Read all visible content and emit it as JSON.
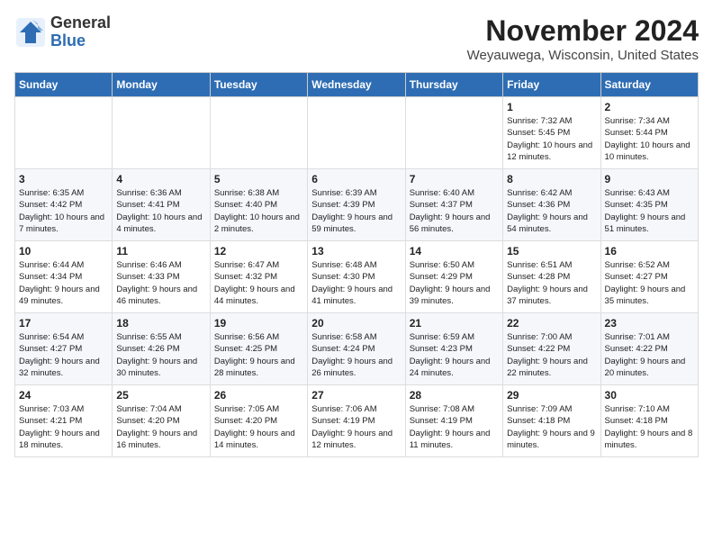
{
  "header": {
    "logo_general": "General",
    "logo_blue": "Blue",
    "month_title": "November 2024",
    "location": "Weyauwega, Wisconsin, United States"
  },
  "weekdays": [
    "Sunday",
    "Monday",
    "Tuesday",
    "Wednesday",
    "Thursday",
    "Friday",
    "Saturday"
  ],
  "weeks": [
    [
      {
        "day": "",
        "info": ""
      },
      {
        "day": "",
        "info": ""
      },
      {
        "day": "",
        "info": ""
      },
      {
        "day": "",
        "info": ""
      },
      {
        "day": "",
        "info": ""
      },
      {
        "day": "1",
        "info": "Sunrise: 7:32 AM\nSunset: 5:45 PM\nDaylight: 10 hours and 12 minutes."
      },
      {
        "day": "2",
        "info": "Sunrise: 7:34 AM\nSunset: 5:44 PM\nDaylight: 10 hours and 10 minutes."
      }
    ],
    [
      {
        "day": "3",
        "info": "Sunrise: 6:35 AM\nSunset: 4:42 PM\nDaylight: 10 hours and 7 minutes."
      },
      {
        "day": "4",
        "info": "Sunrise: 6:36 AM\nSunset: 4:41 PM\nDaylight: 10 hours and 4 minutes."
      },
      {
        "day": "5",
        "info": "Sunrise: 6:38 AM\nSunset: 4:40 PM\nDaylight: 10 hours and 2 minutes."
      },
      {
        "day": "6",
        "info": "Sunrise: 6:39 AM\nSunset: 4:39 PM\nDaylight: 9 hours and 59 minutes."
      },
      {
        "day": "7",
        "info": "Sunrise: 6:40 AM\nSunset: 4:37 PM\nDaylight: 9 hours and 56 minutes."
      },
      {
        "day": "8",
        "info": "Sunrise: 6:42 AM\nSunset: 4:36 PM\nDaylight: 9 hours and 54 minutes."
      },
      {
        "day": "9",
        "info": "Sunrise: 6:43 AM\nSunset: 4:35 PM\nDaylight: 9 hours and 51 minutes."
      }
    ],
    [
      {
        "day": "10",
        "info": "Sunrise: 6:44 AM\nSunset: 4:34 PM\nDaylight: 9 hours and 49 minutes."
      },
      {
        "day": "11",
        "info": "Sunrise: 6:46 AM\nSunset: 4:33 PM\nDaylight: 9 hours and 46 minutes."
      },
      {
        "day": "12",
        "info": "Sunrise: 6:47 AM\nSunset: 4:32 PM\nDaylight: 9 hours and 44 minutes."
      },
      {
        "day": "13",
        "info": "Sunrise: 6:48 AM\nSunset: 4:30 PM\nDaylight: 9 hours and 41 minutes."
      },
      {
        "day": "14",
        "info": "Sunrise: 6:50 AM\nSunset: 4:29 PM\nDaylight: 9 hours and 39 minutes."
      },
      {
        "day": "15",
        "info": "Sunrise: 6:51 AM\nSunset: 4:28 PM\nDaylight: 9 hours and 37 minutes."
      },
      {
        "day": "16",
        "info": "Sunrise: 6:52 AM\nSunset: 4:27 PM\nDaylight: 9 hours and 35 minutes."
      }
    ],
    [
      {
        "day": "17",
        "info": "Sunrise: 6:54 AM\nSunset: 4:27 PM\nDaylight: 9 hours and 32 minutes."
      },
      {
        "day": "18",
        "info": "Sunrise: 6:55 AM\nSunset: 4:26 PM\nDaylight: 9 hours and 30 minutes."
      },
      {
        "day": "19",
        "info": "Sunrise: 6:56 AM\nSunset: 4:25 PM\nDaylight: 9 hours and 28 minutes."
      },
      {
        "day": "20",
        "info": "Sunrise: 6:58 AM\nSunset: 4:24 PM\nDaylight: 9 hours and 26 minutes."
      },
      {
        "day": "21",
        "info": "Sunrise: 6:59 AM\nSunset: 4:23 PM\nDaylight: 9 hours and 24 minutes."
      },
      {
        "day": "22",
        "info": "Sunrise: 7:00 AM\nSunset: 4:22 PM\nDaylight: 9 hours and 22 minutes."
      },
      {
        "day": "23",
        "info": "Sunrise: 7:01 AM\nSunset: 4:22 PM\nDaylight: 9 hours and 20 minutes."
      }
    ],
    [
      {
        "day": "24",
        "info": "Sunrise: 7:03 AM\nSunset: 4:21 PM\nDaylight: 9 hours and 18 minutes."
      },
      {
        "day": "25",
        "info": "Sunrise: 7:04 AM\nSunset: 4:20 PM\nDaylight: 9 hours and 16 minutes."
      },
      {
        "day": "26",
        "info": "Sunrise: 7:05 AM\nSunset: 4:20 PM\nDaylight: 9 hours and 14 minutes."
      },
      {
        "day": "27",
        "info": "Sunrise: 7:06 AM\nSunset: 4:19 PM\nDaylight: 9 hours and 12 minutes."
      },
      {
        "day": "28",
        "info": "Sunrise: 7:08 AM\nSunset: 4:19 PM\nDaylight: 9 hours and 11 minutes."
      },
      {
        "day": "29",
        "info": "Sunrise: 7:09 AM\nSunset: 4:18 PM\nDaylight: 9 hours and 9 minutes."
      },
      {
        "day": "30",
        "info": "Sunrise: 7:10 AM\nSunset: 4:18 PM\nDaylight: 9 hours and 8 minutes."
      }
    ]
  ]
}
